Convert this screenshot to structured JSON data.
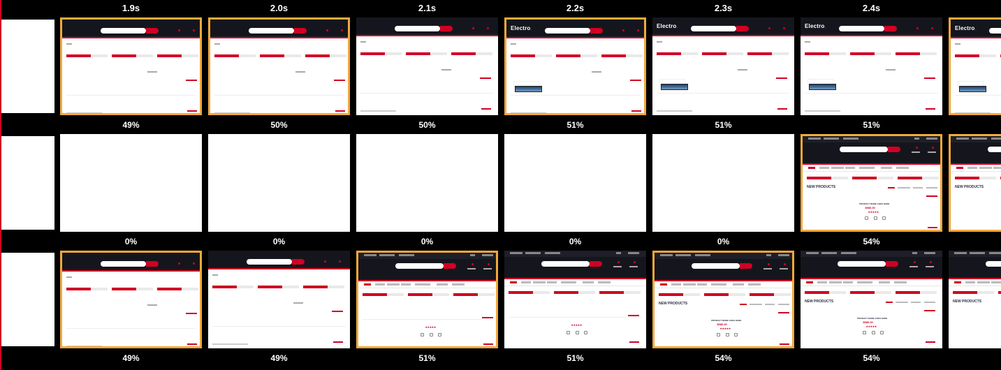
{
  "timeline": {
    "times": [
      "1.9s",
      "2.0s",
      "2.1s",
      "2.2s",
      "2.3s",
      "2.4s"
    ]
  },
  "rows": [
    {
      "percents": [
        "49%",
        "50%",
        "50%",
        "51%",
        "51%",
        "51%"
      ]
    },
    {
      "percents": [
        "0%",
        "0%",
        "0%",
        "0%",
        "0%",
        "54%"
      ]
    },
    {
      "percents": [
        "49%",
        "49%",
        "51%",
        "51%",
        "54%",
        "54%"
      ]
    }
  ],
  "site": {
    "logo": "Electro",
    "logo_dot": ".",
    "section_title": "NEW PRODUCTS",
    "product_name": "PRODUCT NAME GOES HERE",
    "product_price": "$980.00",
    "stars": "★★★★★"
  },
  "colors": {
    "highlight": "#f2a93b",
    "brand_red": "#d10024",
    "header_dark": "#15161d"
  }
}
